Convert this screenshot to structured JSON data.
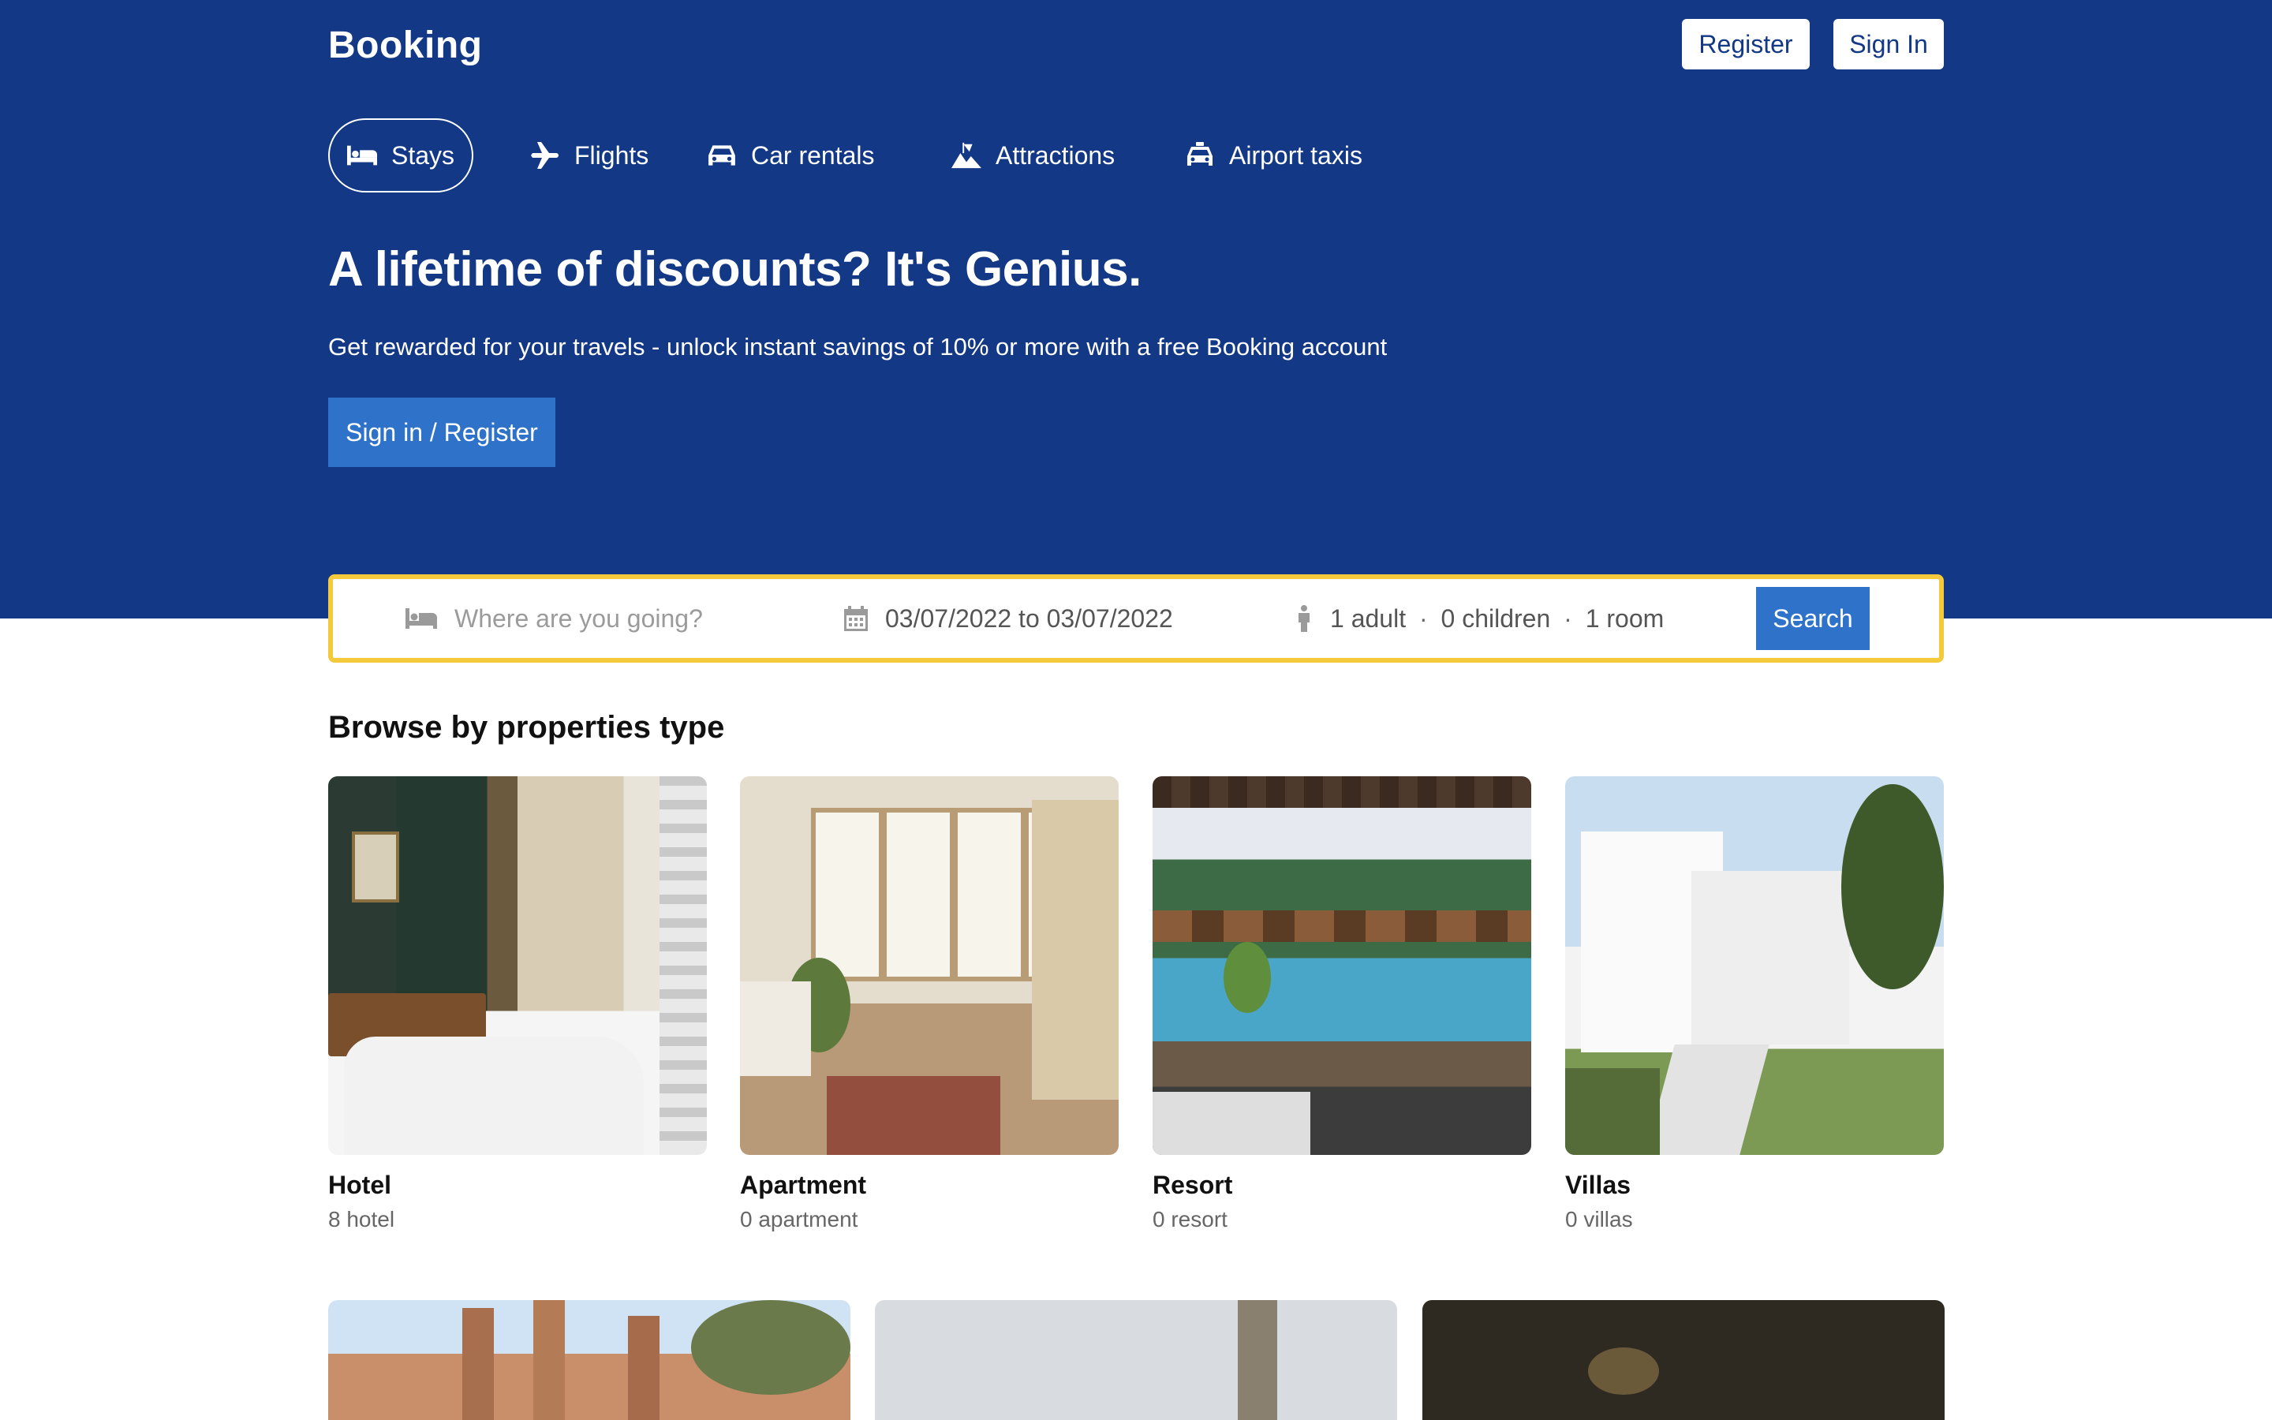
{
  "header": {
    "logo": "Booking",
    "register_label": "Register",
    "signin_label": "Sign In"
  },
  "nav": {
    "items": [
      {
        "label": "Stays",
        "icon": "bed-icon",
        "active": true
      },
      {
        "label": "Flights",
        "icon": "plane-icon",
        "active": false
      },
      {
        "label": "Car rentals",
        "icon": "car-icon",
        "active": false
      },
      {
        "label": "Attractions",
        "icon": "attractions-icon",
        "active": false
      },
      {
        "label": "Airport taxis",
        "icon": "taxi-icon",
        "active": false
      }
    ]
  },
  "hero": {
    "headline": "A lifetime of discounts? It's Genius.",
    "subline": "Get rewarded for your travels - unlock instant savings of 10% or more with a free Booking account",
    "cta_label": "Sign in / Register"
  },
  "search": {
    "destination_placeholder": "Where are you going?",
    "date_range": "03/07/2022 to 03/07/2022",
    "adults": "1 adult",
    "children": "0 children",
    "rooms": "1 room",
    "separator": "·",
    "button_label": "Search"
  },
  "properties": {
    "title": "Browse by properties type",
    "items": [
      {
        "name": "Hotel",
        "count": "8 hotel"
      },
      {
        "name": "Apartment",
        "count": "0 apartment"
      },
      {
        "name": "Resort",
        "count": "0 resort"
      },
      {
        "name": "Villas",
        "count": "0 villas"
      }
    ]
  },
  "colors": {
    "brand_blue": "#133886",
    "button_blue": "#2f72c9",
    "search_border": "#f4c93b"
  }
}
